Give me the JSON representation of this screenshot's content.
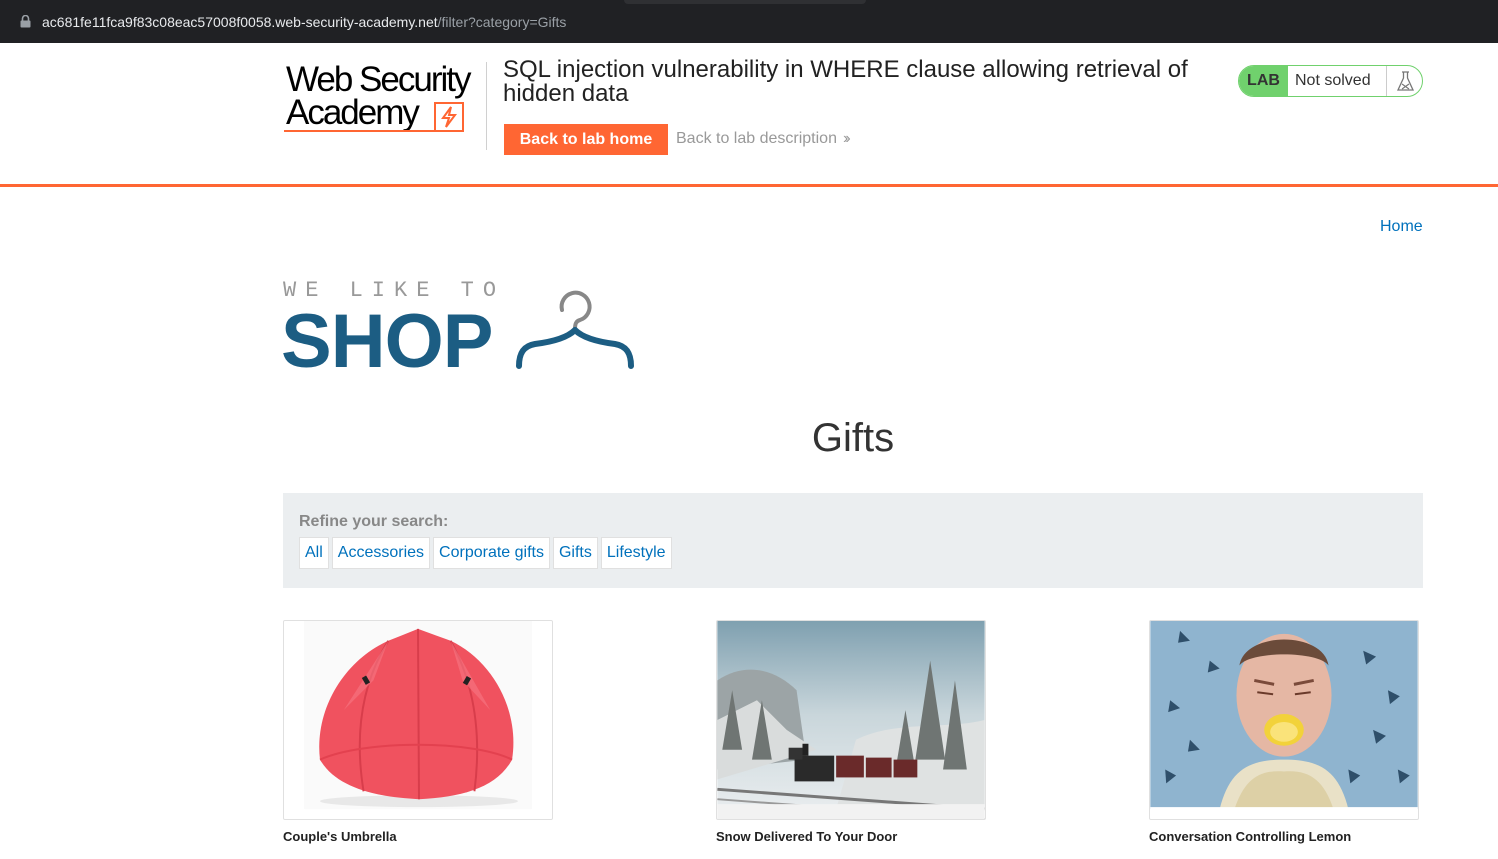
{
  "browser": {
    "url_host": "ac681fe11fca9f83c08eac57008f0058.web-security-academy.net",
    "url_path": "/filter?category=Gifts"
  },
  "lab_header": {
    "logo_line1": "Web Security",
    "logo_line2": "Academy",
    "title": "SQL injection vulnerability in WHERE clause allowing retrieval of hidden data",
    "back_home_label": "Back to lab home",
    "back_description_label": "Back to lab description",
    "status_tag": "LAB",
    "status_text": "Not solved",
    "accent_color": "#ff6633",
    "status_color": "#70d16d"
  },
  "nav": {
    "home_label": "Home"
  },
  "shop_logo": {
    "tagline": "WE LIKE TO",
    "word": "SHOP",
    "brand_color": "#1c5d83"
  },
  "category_title": "Gifts",
  "filter": {
    "label": "Refine your search:",
    "categories": [
      "All",
      "Accessories",
      "Corporate gifts",
      "Gifts",
      "Lifestyle"
    ]
  },
  "products": [
    {
      "name": "Couple's Umbrella",
      "image": "red-umbrella"
    },
    {
      "name": "Snow Delivered To Your Door",
      "image": "snowy-steam-train"
    },
    {
      "name": "Conversation Controlling Lemon",
      "image": "man-biting-lemon"
    }
  ]
}
